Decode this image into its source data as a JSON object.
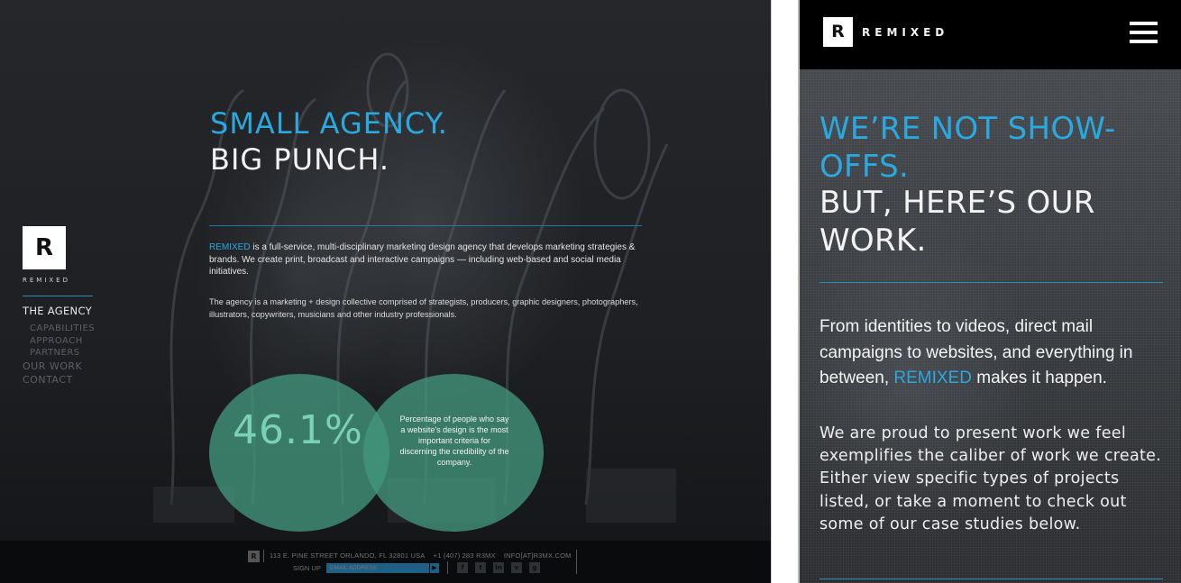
{
  "desktop": {
    "logo": {
      "letter": "R",
      "word": "REMIXED"
    },
    "nav": {
      "agency": "THE AGENCY",
      "capabilities": "CAPABILITIES",
      "approach": "APPROACH",
      "partners": "PARTNERS",
      "our_work": "OUR WORK",
      "contact": "CONTACT"
    },
    "headline_1": "SMALL AGENCY.",
    "headline_2": "BIG PUNCH.",
    "intro_highlight": "REMIXED",
    "intro_rest": " is a full-service, multi-disciplinary marketing design agency that develops marketing strategies & brands. We create print, broadcast and interactive campaigns — including web-based and social media initiatives.",
    "collective": "The agency is a marketing + design collective comprised of strategists, producers, graphic designers, photographers, illustrators, copywriters, musicians and other industry professionals.",
    "stat": {
      "value": "46.1%",
      "caption": "Percentage of people who say a website's design is the most important criteria for discerning the credibility of the company."
    },
    "footer": {
      "logo_letter": "R",
      "address": "113 E. PINE STREET ORLANDO, FL 32801 USA",
      "phone": "+1 (407) 283 R3MX",
      "email": "INFO[AT]R3MX.COM",
      "signup_label": "SIGN UP",
      "signup_placeholder": "EMAIL ADDRESS",
      "go_glyph": "▶",
      "social": [
        "f",
        "t",
        "in",
        "v",
        "g"
      ]
    },
    "colors": {
      "accent": "#2aa9e0",
      "circle": "#42967c"
    }
  },
  "mobile": {
    "logo_letter": "R",
    "wordmark": "REMIXED",
    "headline_1": "WE’RE NOT SHOW-OFFS.",
    "headline_2": "BUT, HERE’S OUR WORK.",
    "para1_before": "From identities to videos, direct mail campaigns to websites, and everything in between, ",
    "para1_highlight": "REMIXED",
    "para1_after": " makes it happen.",
    "para2": "We are proud to present work we feel exemplifies the caliber of work we create. Either view specific types of projects listed, or take a moment to check out some of our case studies below.",
    "menu_icon": "hamburger-icon"
  }
}
